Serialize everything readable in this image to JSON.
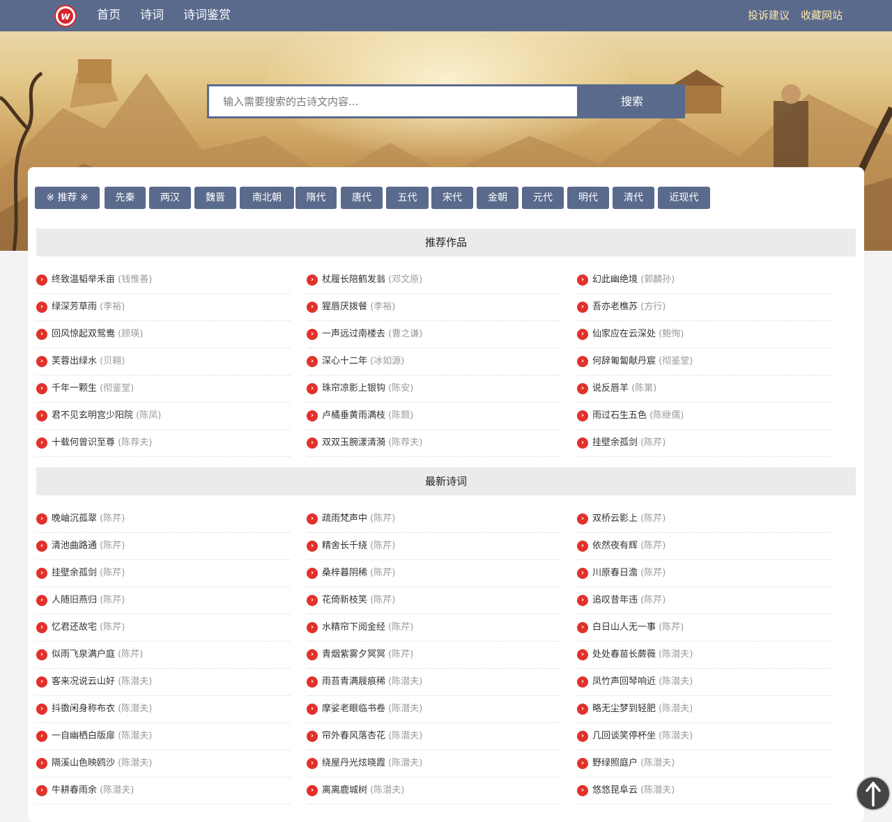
{
  "nav": {
    "logo_letter": "w",
    "links": [
      "首页",
      "诗词",
      "诗词鉴赏"
    ],
    "right_links": [
      "投诉建议",
      "收藏网站"
    ]
  },
  "search": {
    "placeholder": "输入需要搜索的古诗文内容...",
    "button": "搜索"
  },
  "dynasty_tabs": [
    "※ 推荐 ※",
    "先秦",
    "两汉",
    "魏晋",
    "南北朝",
    "隋代",
    "唐代",
    "五代",
    "宋代",
    "金朝",
    "元代",
    "明代",
    "清代",
    "近现代"
  ],
  "sections": [
    {
      "title": "推荐作品",
      "items": [
        {
          "title": "终致温韬举禾亩",
          "author": "(钱惟善)"
        },
        {
          "title": "杖履长陪鹤发翁",
          "author": "(邓文原)"
        },
        {
          "title": "幻此幽绝境",
          "author": "(郭麟孙)"
        },
        {
          "title": "绿深芳草雨",
          "author": "(李裕)"
        },
        {
          "title": "猩唇厌拨餐",
          "author": "(李裕)"
        },
        {
          "title": "吾亦老樵苏",
          "author": "(方行)"
        },
        {
          "title": "回风惊起双鸳鸯",
          "author": "(顾瑛)"
        },
        {
          "title": "一声远过南楼去",
          "author": "(曹之谦)"
        },
        {
          "title": "仙家应在云深处",
          "author": "(鲍恂)"
        },
        {
          "title": "芙蓉出绿水",
          "author": "(贝翱)"
        },
        {
          "title": "深心十二年",
          "author": "(冰如源)"
        },
        {
          "title": "何辞匍匐献丹宸",
          "author": "(彻鉴堂)"
        },
        {
          "title": "千年一颗生",
          "author": "(彻鉴堂)"
        },
        {
          "title": "珠帘凉影上银钩",
          "author": "(陈安)"
        },
        {
          "title": "说反唇羊",
          "author": "(陈第)"
        },
        {
          "title": "君不见玄明宫少阳院",
          "author": "(陈凤)"
        },
        {
          "title": "卢橘垂黄雨满枝",
          "author": "(陈颢)"
        },
        {
          "title": "雨过石生五色",
          "author": "(陈继儒)"
        },
        {
          "title": "十载何曾识至尊",
          "author": "(陈荐夫)"
        },
        {
          "title": "双双玉腕漾清漪",
          "author": "(陈荐夫)"
        },
        {
          "title": "挂壁余孤剑",
          "author": "(陈芹)"
        }
      ]
    },
    {
      "title": "最新诗词",
      "items": [
        {
          "title": "晚岫沉孤翠",
          "author": "(陈芹)"
        },
        {
          "title": "疏雨梵声中",
          "author": "(陈芹)"
        },
        {
          "title": "双桥云影上",
          "author": "(陈芹)"
        },
        {
          "title": "清池曲路通",
          "author": "(陈芹)"
        },
        {
          "title": "精舍长千绕",
          "author": "(陈芹)"
        },
        {
          "title": "依然夜有辉",
          "author": "(陈芹)"
        },
        {
          "title": "挂壁余孤剑",
          "author": "(陈芹)"
        },
        {
          "title": "桑梓暮阴稀",
          "author": "(陈芹)"
        },
        {
          "title": "川原春日澹",
          "author": "(陈芹)"
        },
        {
          "title": "人随旧燕归",
          "author": "(陈芹)"
        },
        {
          "title": "花倚新枝笑",
          "author": "(陈芹)"
        },
        {
          "title": "追叹昔年违",
          "author": "(陈芹)"
        },
        {
          "title": "忆君还故宅",
          "author": "(陈芹)"
        },
        {
          "title": "水精帘下阅金经",
          "author": "(陈芹)"
        },
        {
          "title": "白日山人无一事",
          "author": "(陈芹)"
        },
        {
          "title": "似雨飞泉满户庭",
          "author": "(陈芹)"
        },
        {
          "title": "青烟紫雾夕冥冥",
          "author": "(陈芹)"
        },
        {
          "title": "处处春苗长蕨薇",
          "author": "(陈潜夫)"
        },
        {
          "title": "客来况说云山好",
          "author": "(陈潜夫)"
        },
        {
          "title": "雨苔青满屐痕稀",
          "author": "(陈潜夫)"
        },
        {
          "title": "凤竹声回琴响近",
          "author": "(陈潜夫)"
        },
        {
          "title": "抖擞闲身称布衣",
          "author": "(陈潜夫)"
        },
        {
          "title": "摩娑老眼临书卷",
          "author": "(陈潜夫)"
        },
        {
          "title": "略无尘梦到轻肥",
          "author": "(陈潜夫)"
        },
        {
          "title": "一自幽栖白版扉",
          "author": "(陈潜夫)"
        },
        {
          "title": "帘外春风落杏花",
          "author": "(陈潜夫)"
        },
        {
          "title": "几回谈笑停杯坐",
          "author": "(陈潜夫)"
        },
        {
          "title": "隔溪山色映鸥沙",
          "author": "(陈潜夫)"
        },
        {
          "title": "绕屋丹光炫晓霞",
          "author": "(陈潜夫)"
        },
        {
          "title": "野绿照庭户",
          "author": "(陈潜夫)"
        },
        {
          "title": "牛耕春雨余",
          "author": "(陈潜夫)"
        },
        {
          "title": "离离鹿城树",
          "author": "(陈潜夫)"
        },
        {
          "title": "悠悠昆阜云",
          "author": "(陈潜夫)"
        }
      ]
    }
  ],
  "colors": {
    "nav_bg": "#5a6a8c",
    "bullet": "#e2312b",
    "accent_link": "#ffe9a8"
  }
}
